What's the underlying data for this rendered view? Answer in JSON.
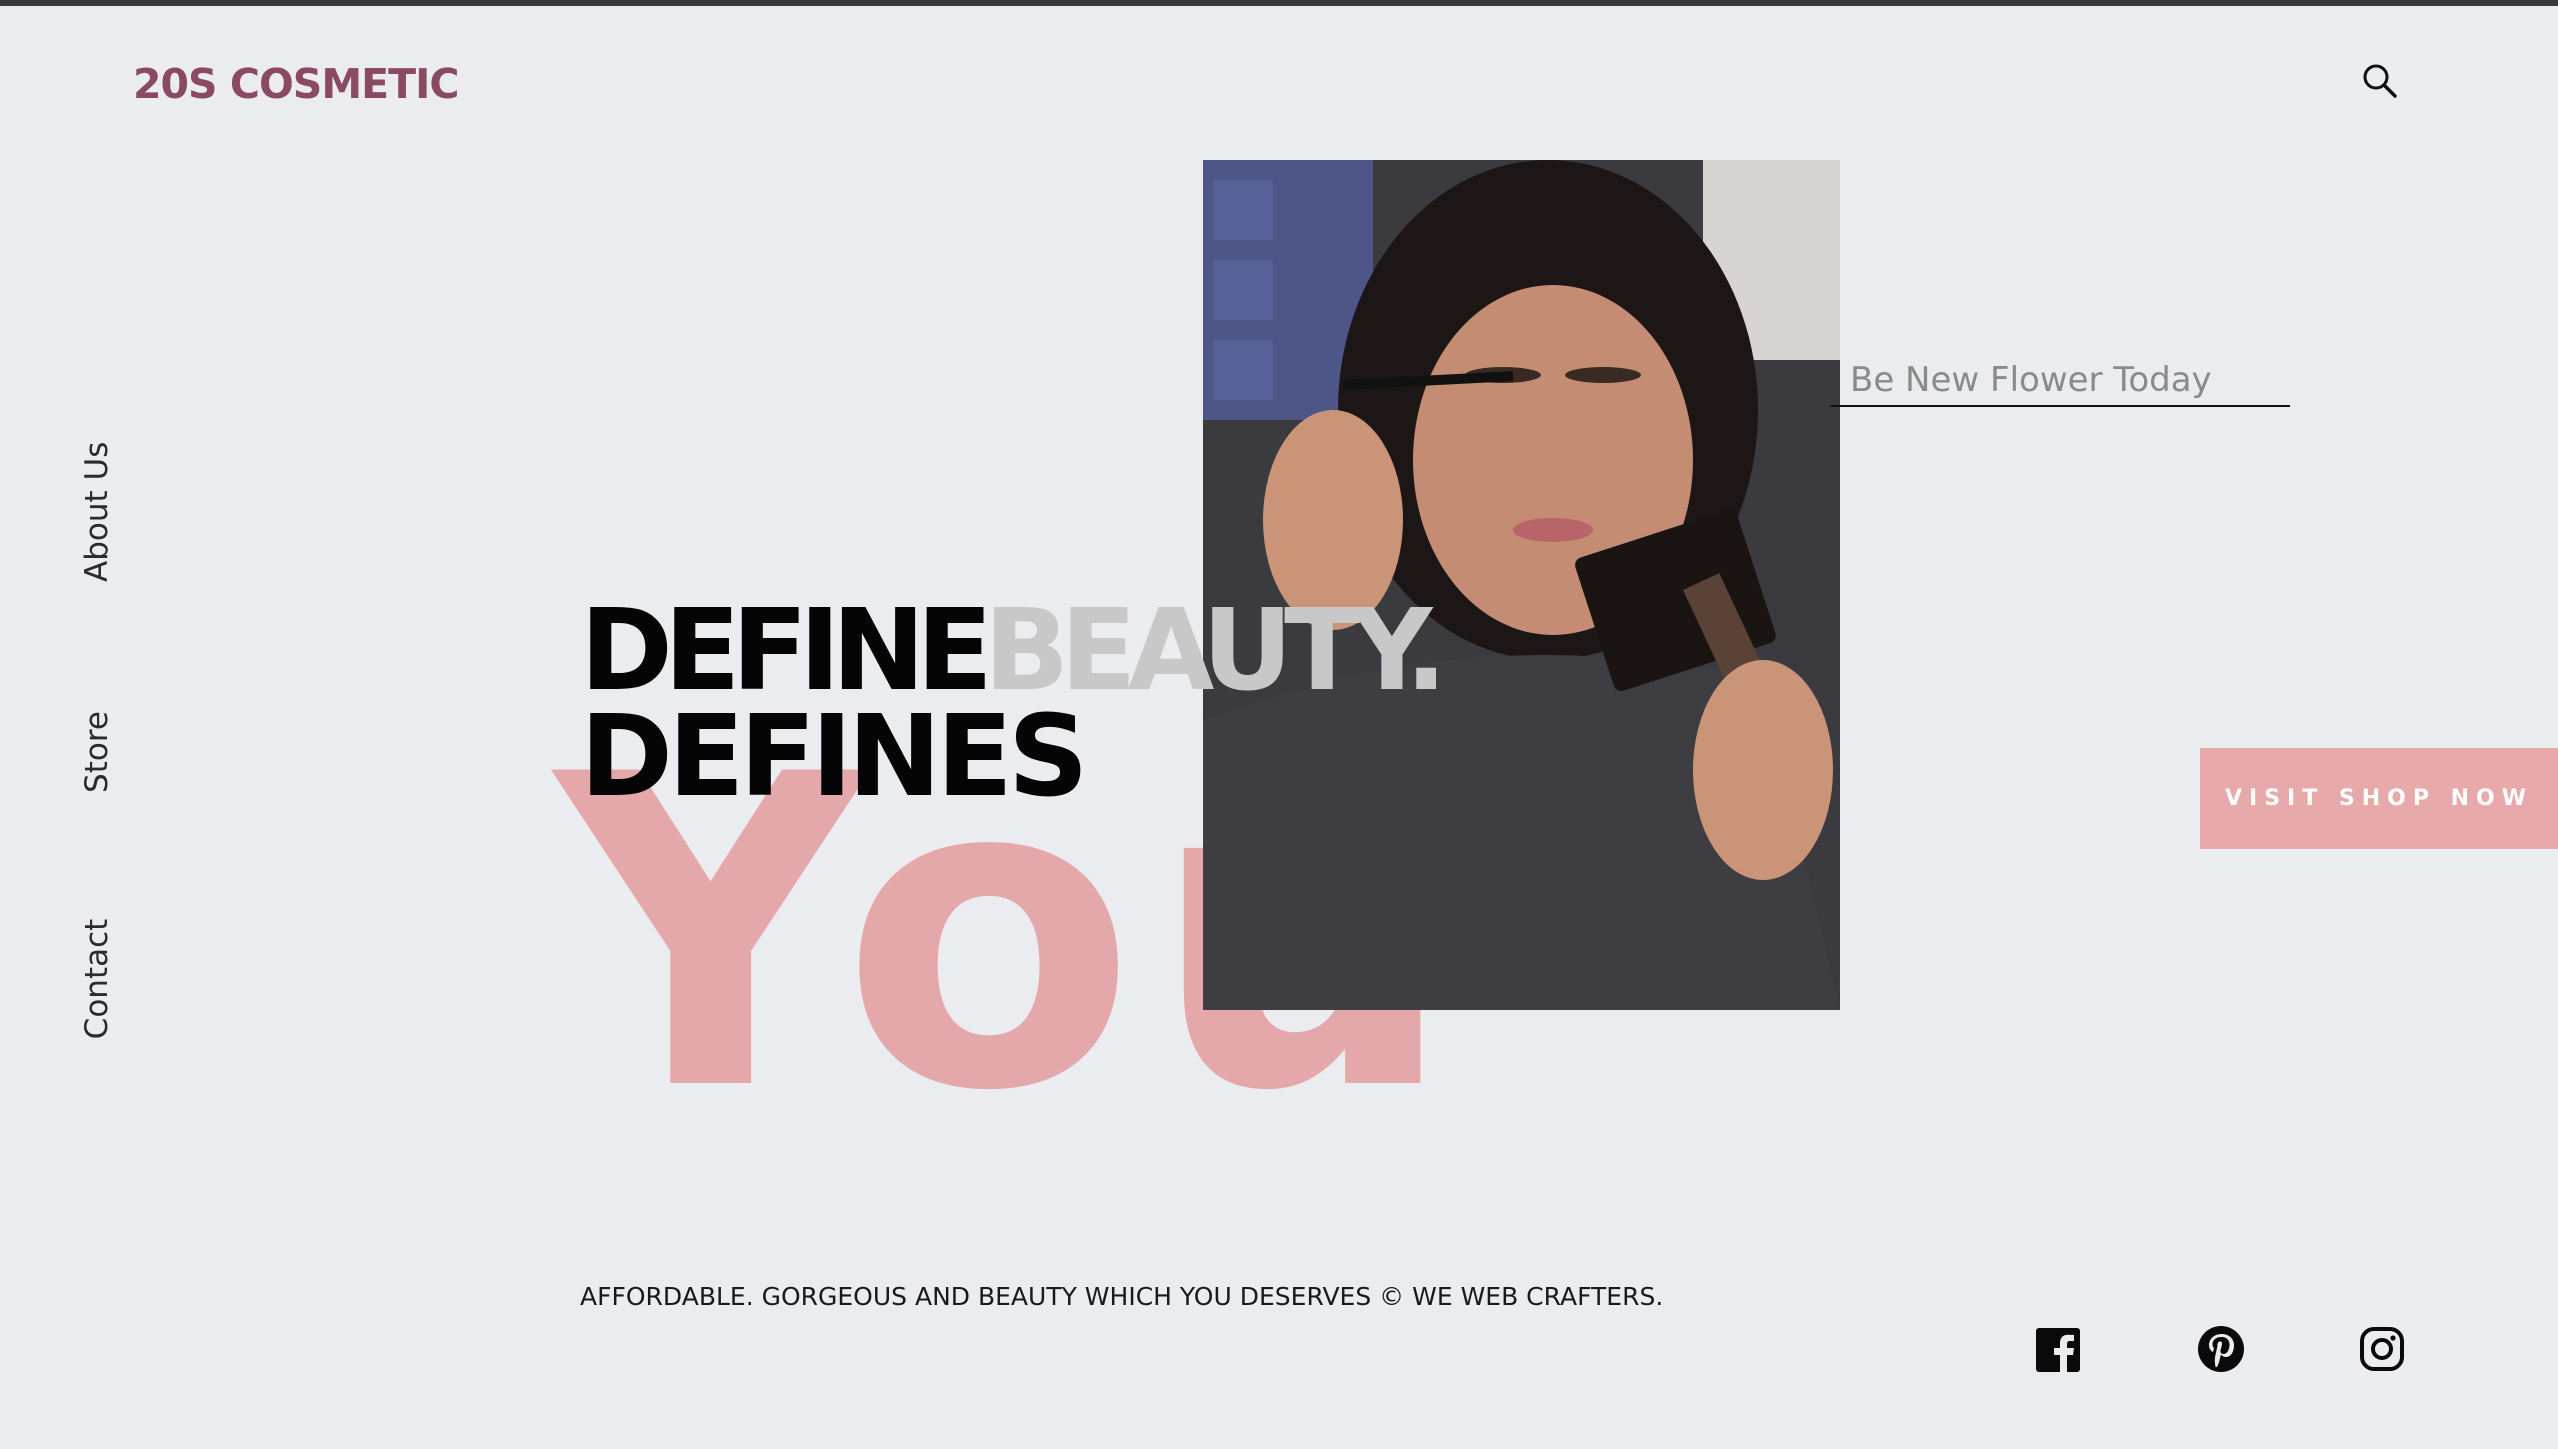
{
  "header": {
    "brand": "20S COSMETIC",
    "search_icon": "search-icon"
  },
  "side_nav": {
    "items": [
      {
        "label": "About Us"
      },
      {
        "label": "Store"
      },
      {
        "label": "Contact"
      }
    ]
  },
  "hero": {
    "headline_word1": "DEFINE",
    "headline_word2": "BEAUTY",
    "headline_dot": ".",
    "headline_line2": "DEFINES",
    "big_word": "You",
    "tagline": "Be New Flower Today",
    "cta_label": "VISIT SHOP NOW"
  },
  "colors": {
    "background": "#ebecf0",
    "brand": "#8a4a61",
    "accent_pink": "#e4a8aa",
    "muted_gray": "#c8c8c8"
  },
  "footer": {
    "text": "AFFORDABLE. GORGEOUS AND BEAUTY WHICH YOU DESERVES © WE WEB CRAFTERS.",
    "social": [
      {
        "icon": "facebook-icon"
      },
      {
        "icon": "pinterest-icon"
      },
      {
        "icon": "instagram-icon"
      }
    ]
  }
}
